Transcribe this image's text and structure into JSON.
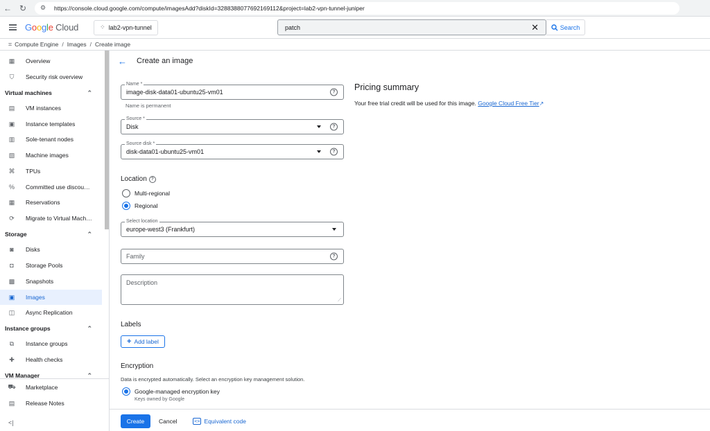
{
  "browser": {
    "url": "https://console.cloud.google.com/compute/imagesAdd?diskId=3288388077692169112&project=lab2-vpn-tunnel-juniper"
  },
  "header": {
    "logo_google": "Google",
    "logo_cloud": "Cloud",
    "project": "lab2-vpn-tunnel",
    "search_value": "patch",
    "search_button": "Search"
  },
  "breadcrumb": {
    "items": [
      "Compute Engine",
      "Images",
      "Create image"
    ]
  },
  "sidebar": {
    "items": [
      {
        "label": "Overview",
        "icon": "grid-icon"
      },
      {
        "label": "Security risk overview",
        "icon": "shield-icon"
      },
      {
        "section": "Virtual machines"
      },
      {
        "label": "VM instances",
        "icon": "server-icon"
      },
      {
        "label": "Instance templates",
        "icon": "template-icon"
      },
      {
        "label": "Sole-tenant nodes",
        "icon": "node-icon"
      },
      {
        "label": "Machine images",
        "icon": "machine-image-icon"
      },
      {
        "label": "TPUs",
        "icon": "tpu-icon"
      },
      {
        "label": "Committed use discou…",
        "icon": "percent-icon"
      },
      {
        "label": "Reservations",
        "icon": "calendar-icon"
      },
      {
        "label": "Migrate to Virtual Mach…",
        "icon": "migrate-icon"
      },
      {
        "section": "Storage"
      },
      {
        "label": "Disks",
        "icon": "disk-icon"
      },
      {
        "label": "Storage Pools",
        "icon": "storage-pool-icon"
      },
      {
        "label": "Snapshots",
        "icon": "snapshot-icon"
      },
      {
        "label": "Images",
        "icon": "image-icon"
      },
      {
        "label": "Async Replication",
        "icon": "replication-icon"
      },
      {
        "section": "Instance groups"
      },
      {
        "label": "Instance groups",
        "icon": "group-icon"
      },
      {
        "label": "Health checks",
        "icon": "health-icon"
      },
      {
        "section": "VM Manager"
      }
    ],
    "bottom": [
      {
        "label": "Marketplace",
        "icon": "marketplace-icon"
      },
      {
        "label": "Release Notes",
        "icon": "notes-icon"
      }
    ]
  },
  "main": {
    "title": "Create an image",
    "name_label": "Name *",
    "name_value": "image-disk-data01-ubuntu25-vm01",
    "name_hint": "Name is permanent",
    "source_label": "Source *",
    "source_value": "Disk",
    "source_disk_label": "Source disk *",
    "source_disk_value": "disk-data01-ubuntu25-vm01",
    "location_title": "Location",
    "location_options": [
      "Multi-regional",
      "Regional"
    ],
    "location_selected": "Regional",
    "select_location_label": "Select location",
    "select_location_value": "europe-west3 (Frankfurt)",
    "family_placeholder": "Family",
    "description_placeholder": "Description",
    "labels_title": "Labels",
    "add_label": "Add label",
    "encryption_title": "Encryption",
    "encryption_desc": "Data is encrypted automatically. Select an encryption key management solution.",
    "encryption_option": "Google-managed encryption key",
    "encryption_option_sub": "Keys owned by Google",
    "create": "Create",
    "cancel": "Cancel",
    "equivalent_code": "Equivalent code"
  },
  "pricing": {
    "title": "Pricing summary",
    "text": "Your free trial credit will be used for this image.",
    "link": "Google Cloud Free Tier"
  },
  "colors": {
    "accent": "#1a73e8",
    "active_bg": "#e8f0fe"
  }
}
